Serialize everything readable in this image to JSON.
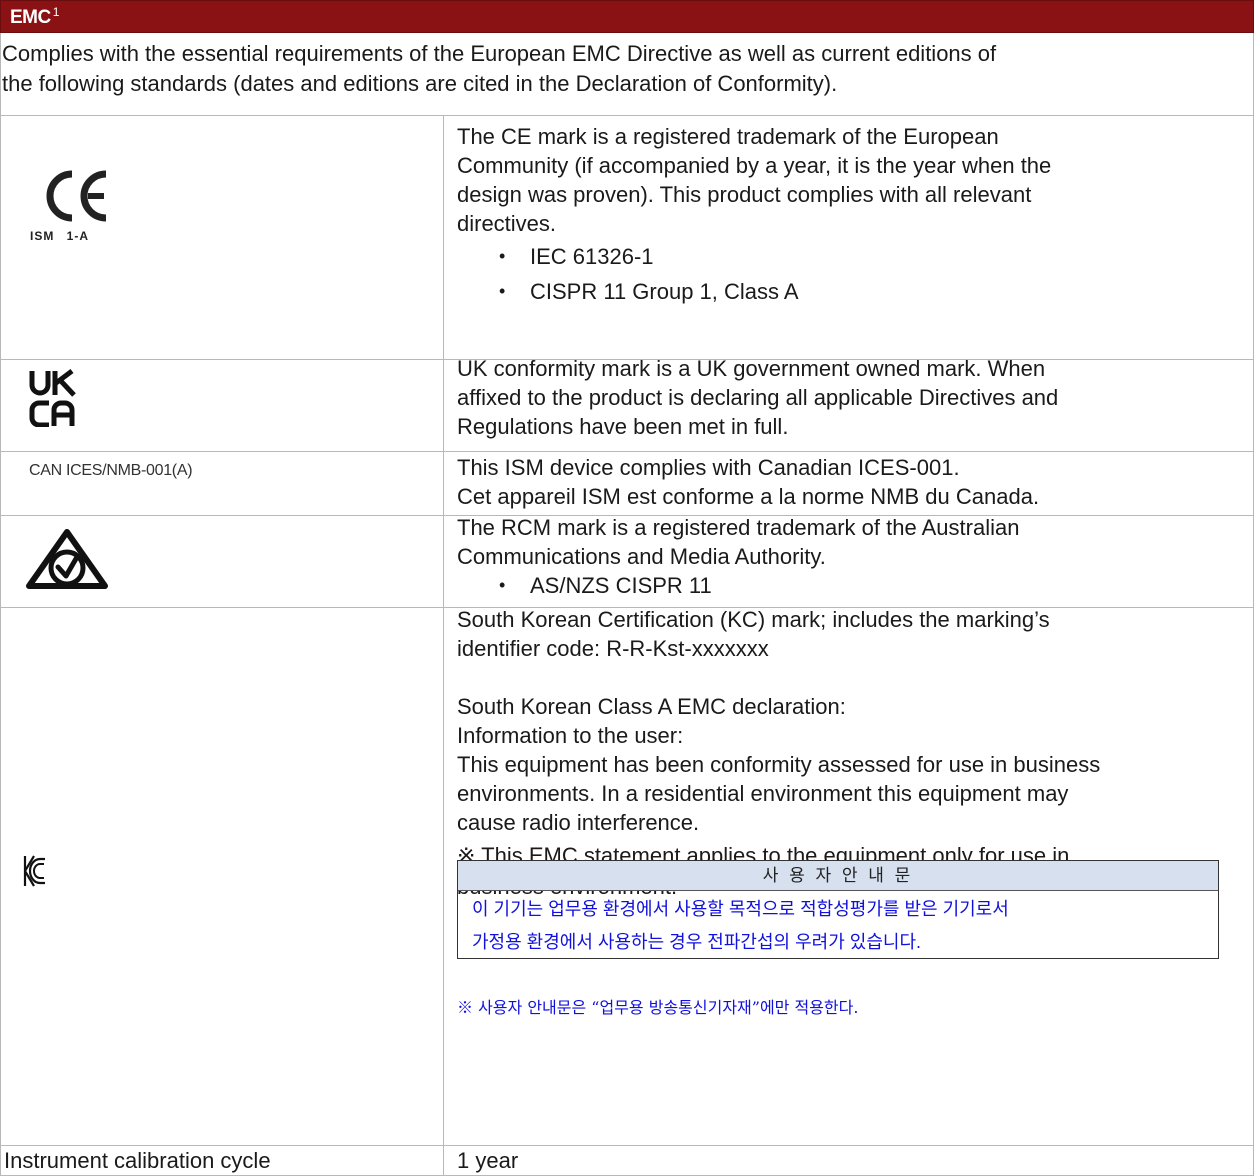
{
  "header": {
    "title": "EMC",
    "superscript": "1"
  },
  "intro": {
    "line1": "Complies with the essential requirements of the European EMC Directive as well as current editions of",
    "line2": "the following standards (dates and editions are cited in the Declaration of Conformity)."
  },
  "ce": {
    "logo_text": "ISM 1-A",
    "lines": [
      "The CE mark is a registered trademark of the European",
      "Community (if accompanied by a year, it is the year when the",
      "design was proven). This product complies with all relevant",
      "directives."
    ],
    "bullets": [
      "IEC 61326-1",
      "CISPR 11 Group 1, Class A"
    ]
  },
  "ukca": {
    "logo_line1": "UK",
    "logo_line2": "CA",
    "lines": [
      "UK conformity mark is a UK government owned mark. When",
      "affixed to the product is declaring all applicable Directives and",
      "Regulations have been met in full."
    ]
  },
  "canada": {
    "label": "CAN ICES/NMB-001(A)",
    "lines": [
      "This ISM device complies with Canadian ICES-001.",
      "Cet appareil ISM est conforme a la norme NMB du Canada."
    ]
  },
  "rcm": {
    "lines": [
      "The RCM mark is a registered trademark of the Australian",
      "Communications and Media Authority."
    ],
    "bullets": [
      "AS/NZS CISPR 11"
    ]
  },
  "kc": {
    "lines": [
      "South Korean Certification (KC) mark; includes the marking’s",
      "identifier code: R-R-Kst-xxxxxxx",
      "",
      "South Korean Class A EMC declaration:",
      "Information to the user:",
      "This equipment has been conformity assessed for use in business",
      "environments. In a residential environment this equipment may",
      "cause radio interference.",
      "※ This EMC statement applies to the equipment only for use in",
      "business environment."
    ],
    "box_header": "사 용 자 안 내 문",
    "box_lines": [
      "이 기기는 업무용 환경에서 사용할 목적으로 적합성평가를 받은 기기로서",
      "가정용 환경에서 사용하는 경우 전파간섭의 우려가 있습니다."
    ],
    "note": "※ 사용자 안내문은 “업무용 방송통신기자재”에만 적용한다."
  },
  "calibration": {
    "label": "Instrument calibration cycle",
    "value": "1 year"
  },
  "colors": {
    "header_bg": "#8b1214",
    "kr_text": "#1111dd",
    "kr_header_bg": "#d6e0ef"
  }
}
